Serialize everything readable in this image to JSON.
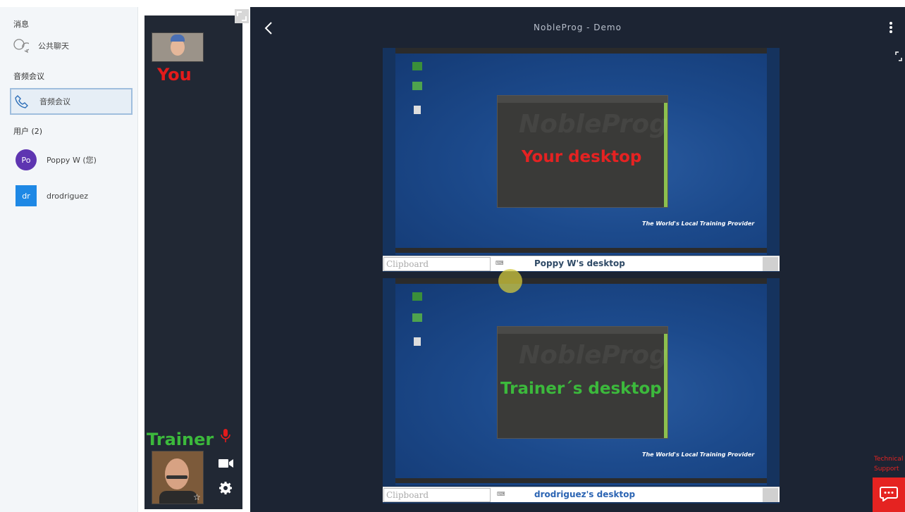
{
  "sidebar": {
    "messages_title": "消息",
    "public_chat": "公共聊天",
    "audio_title": "音频会议",
    "audio_item": "音频会议",
    "users_title": "用户 (2)",
    "users": [
      {
        "initials": "Po",
        "name": "Poppy W (您)",
        "color": "#5e35b1"
      },
      {
        "initials": "dr",
        "name": "drodriguez",
        "color": "#1e88e5"
      }
    ]
  },
  "video": {
    "you_label": "You",
    "trainer_label": "Trainer",
    "you_color": "#e31b1b",
    "trainer_color": "#3cb93c"
  },
  "main": {
    "title": "NobleProg - Demo",
    "top_desktop": {
      "overlay": "Your desktop",
      "overlay_color": "#e52222",
      "label": "Poppy W's desktop",
      "label_color": "#2f4a66",
      "clipboard_placeholder": "Clipboard",
      "watermark": "NobleProg",
      "tagline": "The World's Local Training Provider"
    },
    "bottom_desktop": {
      "overlay": "Trainer´s desktop",
      "overlay_color": "#3cb93c",
      "label": "drodriguez's desktop",
      "label_color": "#2b64b3",
      "clipboard_placeholder": "Clipboard",
      "watermark": "NobleProg",
      "tagline": "The World's Local Training Provider"
    }
  },
  "support": {
    "line1": "Technical",
    "line2": "Support"
  }
}
